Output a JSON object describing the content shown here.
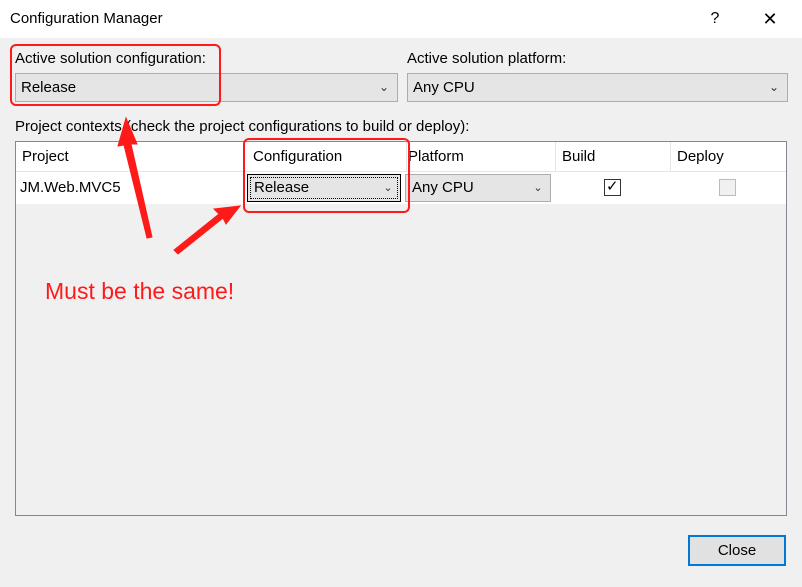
{
  "window": {
    "title": "Configuration Manager",
    "help_label": "?",
    "close_glyph": "✕"
  },
  "active_config": {
    "label": "Active solution configuration:",
    "value": "Release"
  },
  "active_platform": {
    "label": "Active solution platform:",
    "value": "Any CPU"
  },
  "contexts_label": "Project contexts (check the project configurations to build or deploy):",
  "grid": {
    "headers": [
      "Project",
      "Configuration",
      "Platform",
      "Build",
      "Deploy"
    ],
    "rows": [
      {
        "project": "JM.Web.MVC5",
        "configuration": "Release",
        "platform": "Any CPU",
        "build": true,
        "deploy": false
      }
    ]
  },
  "annotation_text": "Must be the same!",
  "buttons": {
    "close": "Close"
  },
  "colors": {
    "annotation": "#ff1a1a",
    "focus_border": "#0078d7"
  },
  "icons": {
    "dropdown": "chevron-down-icon",
    "check": "checkmark-icon"
  }
}
